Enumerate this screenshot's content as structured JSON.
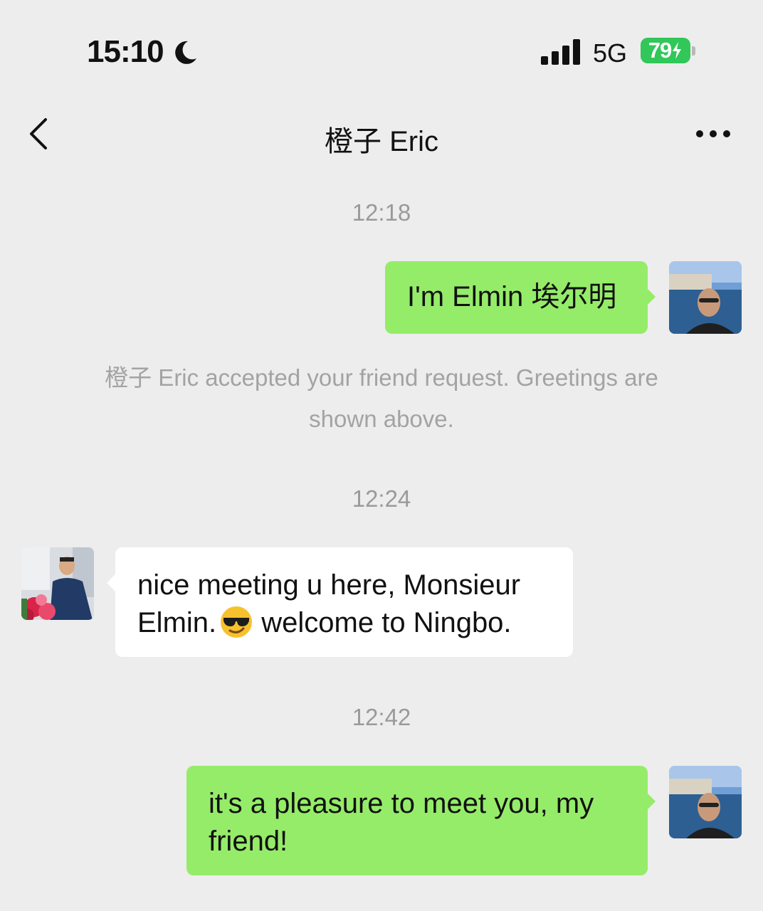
{
  "status_bar": {
    "time": "15:10",
    "network": "5G",
    "battery": "79"
  },
  "icons": {
    "moon": "moon-icon",
    "signal": "signal-icon",
    "battery": "battery-icon",
    "back": "chevron-left-icon",
    "more": "more-icon"
  },
  "header": {
    "title": "橙子 Eric"
  },
  "colors": {
    "outgoing_bubble": "#95ec69",
    "incoming_bubble": "#ffffff",
    "background": "#ededed",
    "battery": "#31c759"
  },
  "chat": {
    "timestamps": [
      "12:18",
      "12:24",
      "12:42"
    ],
    "system_note": "橙子 Eric accepted your friend request. Greetings are shown above.",
    "messages": [
      {
        "direction": "outgoing",
        "text": "I'm Elmin 埃尔明"
      },
      {
        "direction": "incoming",
        "text_part1": "nice meeting u here, Monsieur Elmin.",
        "emoji": "😎",
        "text_part2": " welcome to Ningbo."
      },
      {
        "direction": "outgoing",
        "text": "it's a pleasure to meet you, my friend!"
      }
    ]
  }
}
